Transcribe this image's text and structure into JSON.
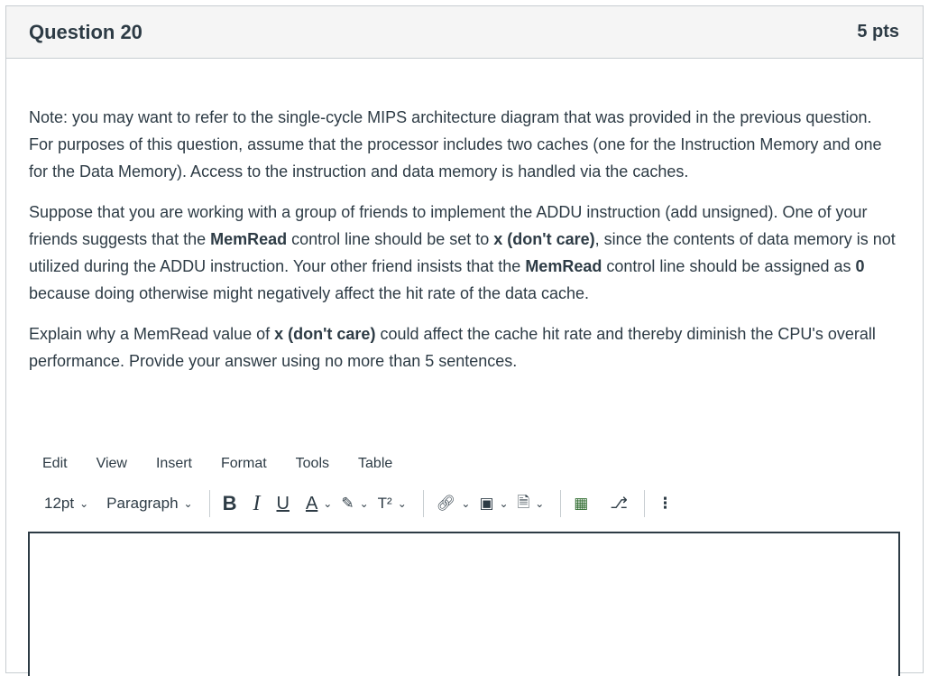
{
  "question": {
    "title": "Question 20",
    "points": "5 pts",
    "paragraphs": {
      "p1": "Note: you may want to refer to the single-cycle MIPS architecture diagram that was provided in the previous question. For purposes of this question, assume that the processor includes two caches (one for the Instruction Memory and one for the Data Memory). Access to the instruction and data memory is handled via the caches.",
      "p2_a": "Suppose that you are working with a group of friends to implement the ADDU instruction (add unsigned). One of your friends suggests that the ",
      "p2_b": "MemRead",
      "p2_c": " control line should be set to ",
      "p2_d": "x (don't care)",
      "p2_e": ", since the contents of data memory is not utilized during the ADDU instruction. Your other friend insists that the ",
      "p2_f": "MemRead",
      "p2_g": " control line should be assigned as ",
      "p2_h": "0",
      "p2_i": " because doing otherwise might negatively affect the hit rate of the data cache.",
      "p3_a": "Explain why a MemRead value of ",
      "p3_b": "x (don't care)",
      "p3_c": " could affect the cache hit rate and thereby diminish the CPU's overall performance. Provide your answer using no more than 5 sentences."
    }
  },
  "editor": {
    "menu": [
      "Edit",
      "View",
      "Insert",
      "Format",
      "Tools",
      "Table"
    ],
    "font_size": "12pt",
    "block_format": "Paragraph",
    "bold_label": "B",
    "italic_label": "I",
    "underline_label": "U",
    "text_color_label": "A",
    "superscript_label": "T²",
    "more_label": "⋮"
  }
}
